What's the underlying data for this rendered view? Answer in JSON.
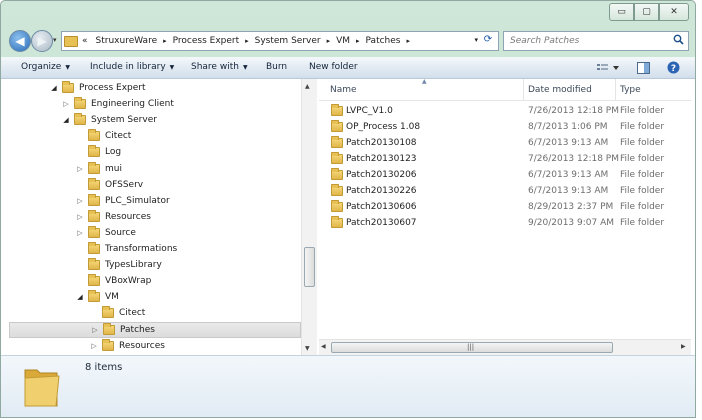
{
  "window": {
    "controls": {
      "minimize": "▭",
      "maximize": "▢",
      "close": "✕"
    }
  },
  "nav": {
    "back_glyph": "◀",
    "forward_glyph": "▶",
    "dropdown_glyph": "▾"
  },
  "address": {
    "overflow": "«",
    "breadcrumbs": [
      "StruxureWare",
      "Process Expert",
      "System Server",
      "VM",
      "Patches"
    ],
    "separator": "▸",
    "dropdown_glyph": "▾",
    "refresh_glyph": "⟳"
  },
  "search": {
    "placeholder": "Search Patches",
    "icon_glyph": "⚲"
  },
  "toolbar": {
    "organize": "Organize",
    "include_in_library": "Include in library",
    "share_with": "Share with",
    "burn": "Burn",
    "new_folder": "New folder",
    "arrow": "▼"
  },
  "tree": [
    {
      "label": "Process Expert",
      "level": 0,
      "expander": "◢"
    },
    {
      "label": "Engineering Client",
      "level": 1,
      "expander": "▷"
    },
    {
      "label": "System Server",
      "level": 1,
      "expander": "◢"
    },
    {
      "label": "Citect",
      "level": 2,
      "expander": ""
    },
    {
      "label": "Log",
      "level": 2,
      "expander": ""
    },
    {
      "label": "mui",
      "level": 2,
      "expander": "▷"
    },
    {
      "label": "OFSServ",
      "level": 2,
      "expander": ""
    },
    {
      "label": "PLC_Simulator",
      "level": 2,
      "expander": "▷"
    },
    {
      "label": "Resources",
      "level": 2,
      "expander": "▷"
    },
    {
      "label": "Source",
      "level": 2,
      "expander": "▷"
    },
    {
      "label": "Transformations",
      "level": 2,
      "expander": ""
    },
    {
      "label": "TypesLibrary",
      "level": 2,
      "expander": ""
    },
    {
      "label": "VBoxWrap",
      "level": 2,
      "expander": ""
    },
    {
      "label": "VM",
      "level": 2,
      "expander": "◢"
    },
    {
      "label": "Citect",
      "level": 3,
      "expander": ""
    },
    {
      "label": "Patches",
      "level": 3,
      "expander": "▷",
      "selected": true
    },
    {
      "label": "Resources",
      "level": 3,
      "expander": "▷"
    }
  ],
  "columns": {
    "name": "Name",
    "date_modified": "Date modified",
    "type": "Type"
  },
  "files": [
    {
      "name": "LVPC_V1.0",
      "date": "7/26/2013 12:18 PM",
      "type": "File folder"
    },
    {
      "name": "OP_Process 1.08",
      "date": "8/7/2013 1:06 PM",
      "type": "File folder"
    },
    {
      "name": "Patch20130108",
      "date": "6/7/2013 9:13 AM",
      "type": "File folder"
    },
    {
      "name": "Patch20130123",
      "date": "7/26/2013 12:18 PM",
      "type": "File folder"
    },
    {
      "name": "Patch20130206",
      "date": "6/7/2013 9:13 AM",
      "type": "File folder"
    },
    {
      "name": "Patch20130226",
      "date": "6/7/2013 9:13 AM",
      "type": "File folder"
    },
    {
      "name": "Patch20130606",
      "date": "8/29/2013 2:37 PM",
      "type": "File folder"
    },
    {
      "name": "Patch20130607",
      "date": "9/20/2013 9:07 AM",
      "type": "File folder"
    }
  ],
  "details": {
    "item_count": "8 items"
  },
  "colors": {
    "frame": "#bcdcc8",
    "folder": "#e8c154",
    "selection": "#dcdcdc"
  }
}
